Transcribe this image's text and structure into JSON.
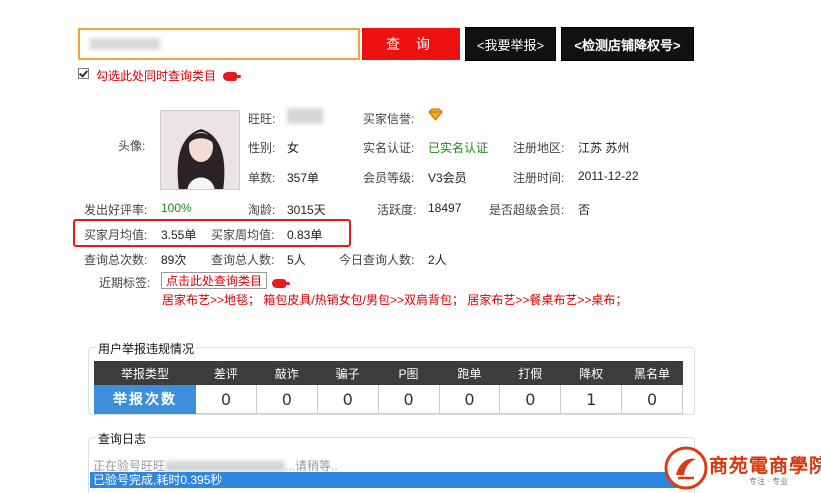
{
  "search": {
    "placeholder": "",
    "query_label": "查 询"
  },
  "buttons": {
    "report": "<我要举报>",
    "detect": "<检测店铺降权号>"
  },
  "checkbox": {
    "checked": true,
    "label": "勾选此处同时查询类目"
  },
  "profile": {
    "avatar_label": "头像:",
    "wangwang_label": "旺旺:",
    "gender_label": "性别:",
    "gender": "女",
    "orders_label": "单数:",
    "orders": "357单",
    "buyer_credit_label": "买家信誉:",
    "realname_label": "实名认证:",
    "realname": "已实名认证",
    "member_level_label": "会员等级:",
    "member_level": "V3会员",
    "region_label": "注册地区:",
    "region": "江苏 苏州",
    "reg_time_label": "注册时间:",
    "reg_time": "2011-12-22",
    "good_rate_label": "发出好评率:",
    "good_rate": "100%",
    "tao_age_label": "淘龄:",
    "tao_age": "3015天",
    "activity_label": "活跃度:",
    "activity": "18497",
    "super_member_label": "是否超级会员:",
    "super_member": "否"
  },
  "averages": {
    "monthly_label": "买家月均值:",
    "monthly": "3.55单",
    "weekly_label": "买家周均值:",
    "weekly": "0.83单"
  },
  "query_stats": {
    "total_label": "查询总次数:",
    "total": "89次",
    "people_label": "查询总人数:",
    "people": "5人",
    "today_label": "今日查询人数:",
    "today": "2人"
  },
  "tags": {
    "label": "近期标签:",
    "button": "点击此处查询类目",
    "line": "居家布艺>>地毯；  箱包皮具/热销女包/男包>>双肩背包；  居家布艺>>餐桌布艺>>桌布；"
  },
  "violations": {
    "title": "用户举报违规情况",
    "headers": [
      "举报类型",
      "差评",
      "敲诈",
      "骗子",
      "P图",
      "跑单",
      "打假",
      "降权",
      "黑名单"
    ],
    "row_label": "举报次数",
    "values": [
      "0",
      "0",
      "0",
      "0",
      "0",
      "0",
      "1",
      "0"
    ]
  },
  "log": {
    "title": "查询日志",
    "line1_prefix": "正在验号旺旺",
    "line1_suffix": "...请稍等..",
    "line2": "已验号完成,耗时0.395秒"
  },
  "logo": {
    "text": "商苑電商學院",
    "slogan": "专注 · 专业"
  },
  "colors": {
    "accent_red": "#ee1111",
    "search_border": "#f3a334",
    "blue": "#3c8fd8",
    "dark": "#3c3c3c"
  }
}
